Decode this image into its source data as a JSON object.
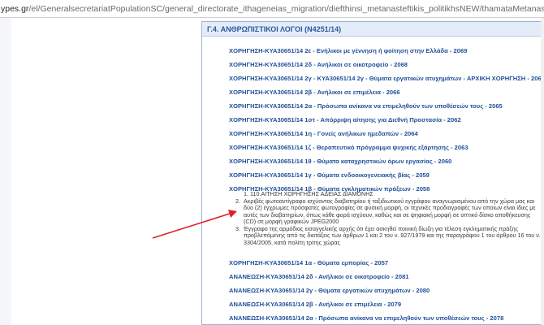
{
  "browser": {
    "url_host": "ypes.gr",
    "url_path": "/el/GeneralsecretariatPopulationSC/general_directorate_ithageneias_migration/diefthinsi_metanasteftikis_politikhsNEW/thamataMetanastfsis/katigories_a"
  },
  "panel": {
    "title": "Γ.4. ΑΝΘΡΩΠΙΣΤΙΚΟΙ ΛΟΓΟΙ (N4251/14)"
  },
  "links_top": [
    "ΧΟΡΗΓΗΣΗ-ΚΥΑ30651/14 2ε - Ενήλικοι με γέννηση ή φοίτηση στην Ελλάδα - 2069",
    "ΧΟΡΗΓΗΣΗ-ΚΥΑ30651/14 2δ - Ανήλικοι σε οικοτροφείο - 2068",
    "ΧΟΡΗΓΗΣΗ-ΚΥΑ30651/14 2γ - ΚΥΑ30651/14 2γ - Θύματα εργατικών ατυχημάτων - ΑΡΧΙΚΗ ΧΟΡΗΓΗΣΗ - 2067",
    "ΧΟΡΗΓΗΣΗ-ΚΥΑ30651/14 2β - Ανήλικοι σε επιμέλεια - 2066",
    "ΧΟΡΗΓΗΣΗ-ΚΥΑ30651/14 2α - Πρόσωπα ανίκανα να επιμεληθούν των υποθέσεών τους - 2065",
    "ΧΟΡΗΓΗΣΗ-ΚΥΑ30651/14 1στ - Απόρριψη αίτησης για Διεθνή Προστασία - 2062",
    "ΧΟΡΗΓΗΣΗ-ΚΥΑ30651/14 1η - Γονείς ανήλικων ημεδαπών - 2064",
    "ΧΟΡΗΓΗΣΗ-ΚΥΑ30651/14 1ζ - Θεραπευτικό πρόγραμμα ψυχικής εξάρτησης - 2063",
    "ΧΟΡΗΓΗΣΗ-ΚΥΑ30651/14 1θ - Θύματα καταχρηστικών όρων εργασίας - 2060",
    "ΧΟΡΗΓΗΣΗ-ΚΥΑ30651/14 1γ - Θύματα ενδοοικογενειακής βίας - 2059",
    "ΧΟΡΗΓΗΣΗ-ΚΥΑ30651/14 1β - Θύματα εγκληματικών πράξεων - 2058"
  ],
  "documents": {
    "heading": "1. 110.ΑΙΤΗΣΗ ΧΟΡΗΓΗΣΗΣ ΑΔΕΙΑΣ ΔΙΑΜΟΝΗΣ",
    "items": [
      {
        "num": "2.",
        "text": "Ακριβές φωτοαντίγραφο ισχύοντος διαβατηρίου ή ταξιδιωτικού εγγράφου αναγνωρισμένου από την χώρα μας και δύο (2) έγχρωμες πρόσφατες φωτογραφίες σε φυσική μορφή, οι τεχνικές προδιαγραφές των οποίων είναι ίδιες με αυτές των διαβατηρίων, όπως κάθε φορά ισχύουν, καθώς και σε ψηφιακή μορφή σε οπτικό δίσκο αποθήκευσης (CD) σε μορφή γραφικών JPEG2000"
      },
      {
        "num": "3.",
        "text": "Έγγραφο της αρμόδιας εισαγγελικής αρχής ότι έχει ασκηθεί ποινική δίωξη για τέλεση εγκληματικής πράξης προβλεπόμενης από τις διατάξεις των άρθρων 1 και 2 του ν. 927/1979 και της παραγράφου 1 του άρθρου 16 του ν. 3304/2005, κατά πολίτη τρίτης χώρας"
      }
    ]
  },
  "links_bottom": [
    "ΧΟΡΗΓΗΣΗ-ΚΥΑ30651/14 1α - Θύματα εμπορίας - 2057",
    "ΑΝΑΝΕΩΣΗ-ΚΥΑ30651/14 2δ - Ανήλικοι σε οικοτροφείο - 2081",
    "ΑΝΑΝΕΩΣΗ-ΚΥΑ30651/14 2γ - Θύματα εργατικών ατυχημάτων - 2080",
    "ΑΝΑΝΕΩΣΗ-ΚΥΑ30651/14 2β - Ανήλικοι σε επιμέλεια - 2079",
    "ΑΝΑΝΕΩΣΗ-ΚΥΑ30651/14 2α - Πρόσωπα ανίκανα να επιμεληθούν των υποθέσεών τους - 2078"
  ],
  "colors": {
    "link": "#1f4f9a",
    "header_bg": "#e3ecf8",
    "arrow": "#e0202a"
  }
}
